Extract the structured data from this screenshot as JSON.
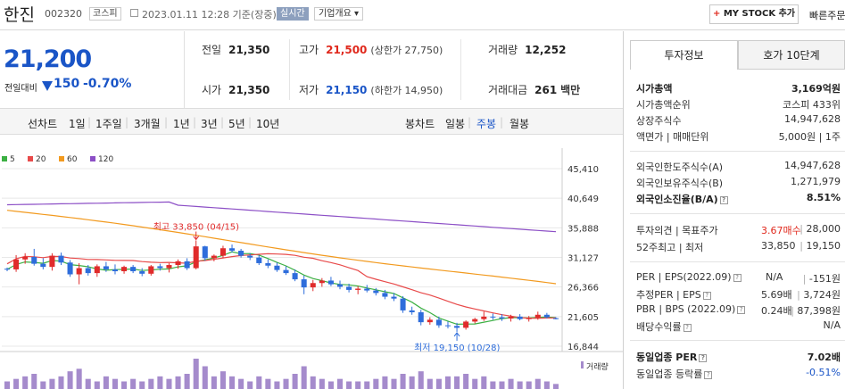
{
  "header": {
    "name": "한진",
    "code": "002320",
    "market": "코스피",
    "timestamp": "2023.01.11 12:28 기준(장중)",
    "realtime": "실시간",
    "overview": "기업개요",
    "overview_arrow": "▾",
    "my_stock_plus": "+",
    "my_stock": "MY STOCK 추가",
    "quick": "빠른주문"
  },
  "price": {
    "current": "21,200",
    "change_label": "전일대비",
    "change": "150",
    "change_pct": "-0.70%"
  },
  "stats": {
    "prev_label": "전일",
    "prev": "21,350",
    "high_label": "고가",
    "high": "21,500",
    "upper_limit": "(상한가 27,750)",
    "volume_label": "거래량",
    "volume": "12,252",
    "open_label": "시가",
    "open": "21,350",
    "low_label": "저가",
    "low": "21,150",
    "lower_limit": "(하한가 14,950)",
    "amount_label": "거래대금",
    "amount": "261",
    "amount_unit": "백만"
  },
  "period_bar": {
    "line_label": "선차트",
    "line_periods": [
      "1일",
      "1주일",
      "3개월",
      "1년",
      "3년",
      "5년",
      "10년"
    ],
    "candle_label": "봉차트",
    "candle_periods": [
      "일봉",
      "주봉",
      "월봉"
    ],
    "candle_selected": 1
  },
  "chart_data": {
    "type": "candlestick",
    "legend": [
      {
        "name": "5",
        "color": "#3cb043"
      },
      {
        "name": "20",
        "color": "#e84a4a"
      },
      {
        "name": "60",
        "color": "#f29a1f"
      },
      {
        "name": "120",
        "color": "#8c4fc6"
      }
    ],
    "yticks": [
      "45,410",
      "40,649",
      "35,888",
      "31,127",
      "26,366",
      "21,605",
      "16,844"
    ],
    "ylim": [
      16844,
      45410
    ],
    "high_annotation": "최고 33,850 (04/15)",
    "low_annotation": "최저 19,150 (10/28)",
    "volume_label": "거래량",
    "candles": [
      [
        29300,
        29500,
        28900,
        29200
      ],
      [
        29200,
        31500,
        28800,
        30800
      ],
      [
        30800,
        31800,
        30100,
        31200
      ],
      [
        31200,
        32500,
        29800,
        30100
      ],
      [
        30100,
        31000,
        29200,
        29600
      ],
      [
        29600,
        31800,
        29000,
        31400
      ],
      [
        31400,
        31900,
        29900,
        30300
      ],
      [
        30300,
        30700,
        28000,
        28400
      ],
      [
        28400,
        30200,
        26800,
        29400
      ],
      [
        29400,
        29900,
        28200,
        28600
      ],
      [
        28600,
        30000,
        28000,
        29700
      ],
      [
        29700,
        30400,
        28800,
        29200
      ],
      [
        29200,
        30000,
        28400,
        28900
      ],
      [
        28900,
        29800,
        28500,
        29600
      ],
      [
        29600,
        29900,
        28600,
        28900
      ],
      [
        28900,
        29400,
        28100,
        28500
      ],
      [
        28500,
        29900,
        28200,
        29700
      ],
      [
        29700,
        30100,
        29000,
        29400
      ],
      [
        29400,
        30200,
        28700,
        29900
      ],
      [
        29900,
        30800,
        29300,
        30500
      ],
      [
        30500,
        31000,
        29100,
        29400
      ],
      [
        29400,
        33850,
        29200,
        32900
      ],
      [
        32900,
        33000,
        30600,
        31000
      ],
      [
        31000,
        31600,
        30500,
        31400
      ],
      [
        31400,
        33000,
        31000,
        32600
      ],
      [
        32600,
        33200,
        31900,
        32200
      ],
      [
        32200,
        32500,
        31100,
        31400
      ],
      [
        31400,
        31800,
        30700,
        31100
      ],
      [
        31100,
        31500,
        29900,
        30200
      ],
      [
        30200,
        30800,
        29400,
        29800
      ],
      [
        29800,
        30300,
        28800,
        29100
      ],
      [
        29100,
        29700,
        28300,
        28600
      ],
      [
        28600,
        29200,
        27300,
        27600
      ],
      [
        27600,
        28200,
        25200,
        26300
      ],
      [
        26300,
        27500,
        25700,
        27000
      ],
      [
        27000,
        27800,
        26400,
        27400
      ],
      [
        27400,
        28000,
        26500,
        26800
      ],
      [
        26800,
        27400,
        26000,
        26400
      ],
      [
        26400,
        26900,
        25500,
        25900
      ],
      [
        25900,
        26500,
        25200,
        26100
      ],
      [
        26100,
        26700,
        25500,
        25800
      ],
      [
        25800,
        26200,
        25000,
        25400
      ],
      [
        25400,
        25900,
        24400,
        24800
      ],
      [
        24800,
        25400,
        24100,
        24500
      ],
      [
        24500,
        24900,
        22200,
        22600
      ],
      [
        22600,
        23200,
        21900,
        22300
      ],
      [
        22300,
        22700,
        20200,
        20700
      ],
      [
        20700,
        21500,
        20300,
        21100
      ],
      [
        21100,
        21600,
        19800,
        20200
      ],
      [
        20200,
        20800,
        19700,
        20100
      ],
      [
        20100,
        20600,
        19150,
        19800
      ],
      [
        19800,
        21000,
        19500,
        20800
      ],
      [
        20800,
        21400,
        20500,
        21200
      ],
      [
        21200,
        22400,
        20900,
        21600
      ],
      [
        21600,
        22100,
        21100,
        21500
      ],
      [
        21500,
        22000,
        20900,
        21300
      ],
      [
        21300,
        21900,
        20800,
        21600
      ],
      [
        21600,
        22000,
        21000,
        21200
      ],
      [
        21200,
        21700,
        20800,
        21400
      ],
      [
        21400,
        22400,
        21100,
        21900
      ],
      [
        21900,
        22200,
        21300,
        21500
      ],
      [
        21350,
        21500,
        21150,
        21200
      ]
    ],
    "volumes": [
      3,
      4,
      5,
      6,
      3,
      4,
      5,
      7,
      8,
      4,
      3,
      5,
      4,
      3,
      4,
      3,
      4,
      5,
      4,
      5,
      6,
      12,
      9,
      5,
      7,
      5,
      4,
      3,
      5,
      4,
      3,
      4,
      6,
      9,
      5,
      4,
      3,
      4,
      3,
      3,
      3,
      4,
      5,
      4,
      6,
      5,
      7,
      4,
      4,
      5,
      5,
      6,
      4,
      5,
      3,
      3,
      4,
      3,
      3,
      4,
      3,
      2
    ]
  },
  "right_panel": {
    "tabs": [
      "투자정보",
      "호가 10단계"
    ],
    "market_cap_label": "시가총액",
    "market_cap": "3,169억원",
    "cap_rank_label": "시가총액순위",
    "cap_rank": "코스피 433위",
    "shares_label": "상장주식수",
    "shares": "14,947,628",
    "par_label": "액면가 | 매매단위",
    "par": "5,000원 | 1주",
    "foreign_limit_label": "외국인한도주식수(A)",
    "foreign_limit": "14,947,628",
    "foreign_hold_label": "외국인보유주식수(B)",
    "foreign_hold": "1,271,979",
    "foreign_ratio_label": "외국인소진율(B/A)",
    "foreign_ratio": "8.51%",
    "opinion_label": "투자의견 | 목표주가",
    "opinion": "3.67매수",
    "target": "28,000",
    "week52_label": "52주최고 | 최저",
    "week52_high": "33,850",
    "week52_low": "19,150",
    "per_label": "PER | EPS(2022.09)",
    "per": "N/A",
    "eps": "-151원",
    "est_per_label": "추정PER | EPS",
    "est_per": "5.69배",
    "est_eps": "3,724원",
    "pbr_label": "PBR | BPS (2022.09)",
    "pbr": "0.24배",
    "bps": "87,398원",
    "div_label": "배당수익률",
    "div": "N/A",
    "ind_per_label": "동일업종 PER",
    "ind_per": "7.02배",
    "ind_rate_label": "동일업종 등락률",
    "ind_rate": "-0.51%"
  }
}
